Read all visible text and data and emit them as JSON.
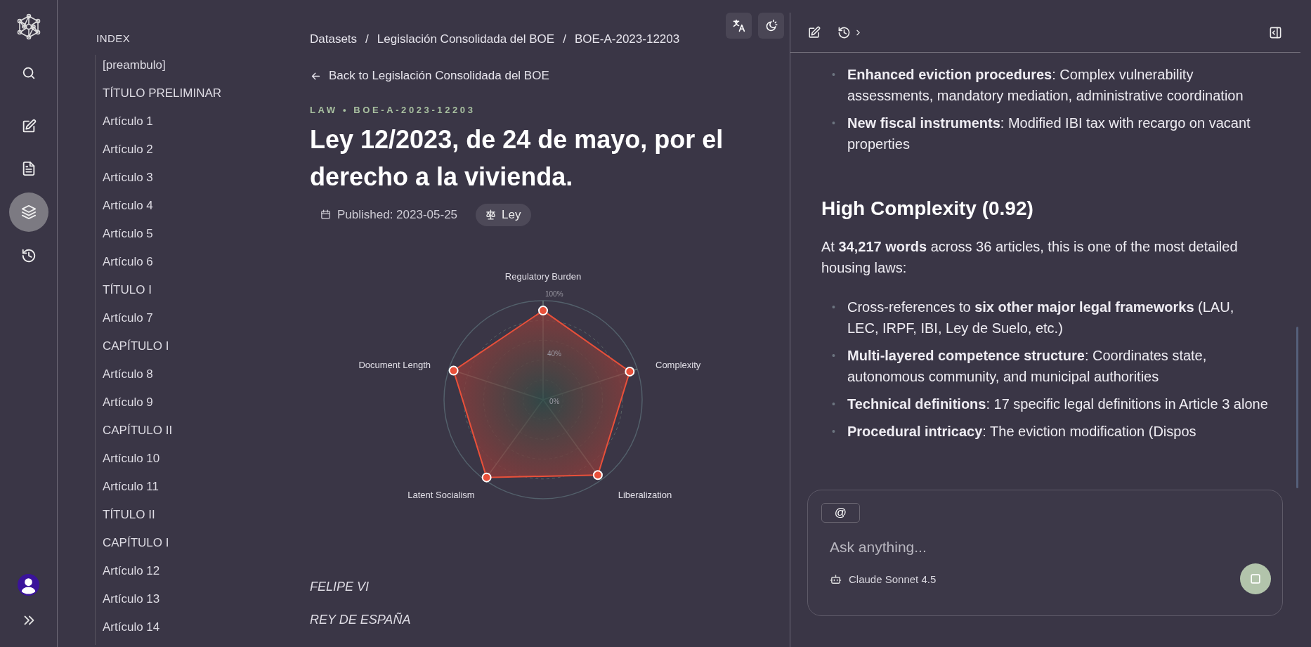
{
  "rail": {
    "nav": [
      {
        "selected": false
      },
      {
        "selected": false
      },
      {
        "selected": false
      },
      {
        "selected": true
      },
      {
        "selected": false
      }
    ]
  },
  "index": {
    "title": "INDEX",
    "items": [
      "[preambulo]",
      "TÍTULO PRELIMINAR",
      "Artículo 1",
      "Artículo 2",
      "Artículo 3",
      "Artículo 4",
      "Artículo 5",
      "Artículo 6",
      "TÍTULO I",
      "Artículo 7",
      "CAPÍTULO I",
      "Artículo 8",
      "Artículo 9",
      "CAPÍTULO II",
      "Artículo 10",
      "Artículo 11",
      "TÍTULO II",
      "CAPÍTULO I",
      "Artículo 12",
      "Artículo 13",
      "Artículo 14"
    ]
  },
  "breadcrumb": {
    "items": [
      "Datasets",
      "Legislación Consolidada del BOE",
      "BOE-A-2023-12203"
    ],
    "separator": "/"
  },
  "back_link": "Back to Legislación Consolidada del BOE",
  "eyebrow": "LAW • BOE-A-2023-12203",
  "title": "Ley 12/2023, de 24 de mayo, por el derecho a la vivienda.",
  "published": "Published: 2023-05-25",
  "type_tag": "Ley",
  "radar": {
    "axes": [
      {
        "label": "Regulatory Burden",
        "level": 0.9
      },
      {
        "label": "Complexity",
        "level": 0.92
      },
      {
        "label": "Liberalization",
        "level": 0.94
      },
      {
        "label": "Latent Socialism",
        "level": 0.97
      },
      {
        "label": "Document Length",
        "level": 0.95
      }
    ],
    "ticks": [
      "100%",
      "40%",
      "0%"
    ]
  },
  "body": [
    "FELIPE VI",
    "REY DE ESPAÑA"
  ],
  "assistant": {
    "blocks": [
      {
        "kind": "bullets",
        "marker": "•",
        "items": [
          "**Enhanced eviction procedures**: Complex vulnerability assessments, mandatory mediation, administrative coordination",
          "**New fiscal instruments**: Modified IBI tax with recargo on vacant properties"
        ]
      },
      {
        "kind": "heading",
        "text": "High Complexity (0.92)"
      },
      {
        "kind": "paragraph",
        "text": "At **34,217 words** across 36 articles, this is one of the most detailed housing laws:"
      },
      {
        "kind": "bullets",
        "marker": "•",
        "items": [
          "Cross-references to **six other major legal frameworks** (LAU, LEC, IRPF, IBI, Ley de Suelo, etc.)",
          "**Multi-layered competence structure**: Coordinates state, autonomous community, and municipal authorities",
          "**Technical definitions**: 17 specific legal definitions in Article 3 alone",
          "**Procedural intricacy**: The eviction modification (Dispos"
        ]
      }
    ],
    "composer": {
      "mention_button": "@",
      "placeholder": "Ask anything...",
      "model": "Claude Sonnet 4.5"
    }
  }
}
